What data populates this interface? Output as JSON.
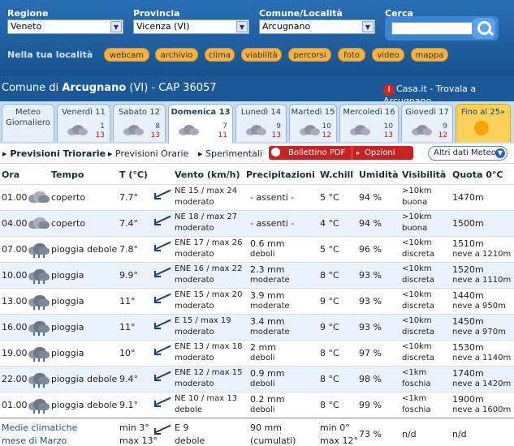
{
  "header": {
    "regione_label": "Regione",
    "regione_value": "Veneto",
    "provincia_label": "Provincia",
    "provincia_value": "Vicenza (VI)",
    "comune_label": "Comune/Località",
    "comune_value": "Arcugnano",
    "cerca_label": "Cerca",
    "cerca_value": "",
    "nella_label": "Nella tua località",
    "pills": [
      "webcam",
      "archivio",
      "clima",
      "viabilità",
      "percorsi",
      "foto",
      "video",
      "mappa"
    ]
  },
  "location_bar": {
    "prefix": "Comune di",
    "name": "Arcugnano",
    "suffix": "(VI) - CAP 36057",
    "casa_link": "Casa.it - Trovala a Arcugnano"
  },
  "day_tabs": [
    {
      "label": "Meteo Giornaliero",
      "lo": "",
      "hi": ""
    },
    {
      "label": "Venerdì 11",
      "lo": "1",
      "hi": "13"
    },
    {
      "label": "Sabato 12",
      "lo": "8",
      "hi": "13"
    },
    {
      "label": "Domenica 13",
      "lo": "7",
      "hi": "11"
    },
    {
      "label": "Lunedì 14",
      "lo": "9",
      "hi": "13"
    },
    {
      "label": "Martedì 15",
      "lo": "10",
      "hi": "12"
    },
    {
      "label": "Mercoledì 16",
      "lo": "10",
      "hi": "13"
    },
    {
      "label": "Giovedì 17",
      "lo": "9",
      "hi": "12"
    },
    {
      "label": "Fino al 25»",
      "lo": "",
      "hi": ""
    }
  ],
  "subnav": {
    "triorarie": "▸ Previsioni Triorarie",
    "orarie": "▸ Previsioni Orarie",
    "sperimentali": "▸ Sperimentali",
    "bollettino": "Bollettino PDF",
    "opzioni": "Opzioni",
    "altri": "Altri dati Meteo"
  },
  "table": {
    "headers": [
      "Ora",
      "Tempo",
      "T (°C)",
      "Vento (km/h)",
      "Precipitazioni",
      "W.chill",
      "Umidità",
      "Visibilità",
      "Quota 0°C"
    ],
    "rows": [
      {
        "ora": "01.00",
        "tempo": "coperto",
        "rain": false,
        "temp": "7.7°",
        "vento1": "NE 15 / max 24",
        "vento2": "moderato",
        "prec1": "- assenti -",
        "prec2": "",
        "wchill": "5 °C",
        "umid": "94 %",
        "vis1": ">10km",
        "vis2": "buona",
        "quota1": "1470m",
        "quota2": ""
      },
      {
        "ora": "04.00",
        "tempo": "coperto",
        "rain": false,
        "temp": "7.4°",
        "vento1": "NE 18 / max 27",
        "vento2": "moderato",
        "prec1": "- assenti -",
        "prec2": "",
        "wchill": "4 °C",
        "umid": "94 %",
        "vis1": ">10km",
        "vis2": "buona",
        "quota1": "1500m",
        "quota2": ""
      },
      {
        "ora": "07.00",
        "tempo": "pioggia debole",
        "rain": true,
        "temp": "7.8°",
        "vento1": "ENE 17 / max 26",
        "vento2": "moderato",
        "prec1": "0.6 mm",
        "prec2": "deboli",
        "wchill": "5 °C",
        "umid": "96 %",
        "vis1": "<10km",
        "vis2": "discreta",
        "quota1": "1510m",
        "quota2": "neve a 1210m"
      },
      {
        "ora": "10.00",
        "tempo": "pioggia",
        "rain": true,
        "temp": "9.9°",
        "vento1": "ENE 16 / max 22",
        "vento2": "moderato",
        "prec1": "2.3 mm",
        "prec2": "moderate",
        "wchill": "8 °C",
        "umid": "93 %",
        "vis1": "<10km",
        "vis2": "discreta",
        "quota1": "1520m",
        "quota2": "neve a 1110m"
      },
      {
        "ora": "13.00",
        "tempo": "pioggia",
        "rain": true,
        "temp": "11°",
        "vento1": "ENE 15 / max 20",
        "vento2": "moderato",
        "prec1": "3.9 mm",
        "prec2": "moderate",
        "wchill": "9 °C",
        "umid": "93 %",
        "vis1": "<10km",
        "vis2": "discreta",
        "quota1": "1440m",
        "quota2": "neve a 950m"
      },
      {
        "ora": "16.00",
        "tempo": "pioggia",
        "rain": true,
        "temp": "11°",
        "vento1": "E 15 / max 19",
        "vento2": "moderato",
        "prec1": "3.4 mm",
        "prec2": "moderate",
        "wchill": "9 °C",
        "umid": "93 %",
        "vis1": "<10km",
        "vis2": "discreta",
        "quota1": "1450m",
        "quota2": "neve a 970m"
      },
      {
        "ora": "19.00",
        "tempo": "pioggia",
        "rain": true,
        "temp": "10°",
        "vento1": "ENE 13 / max 18",
        "vento2": "moderato",
        "prec1": "2 mm",
        "prec2": "deboli",
        "wchill": "8 °C",
        "umid": "97 %",
        "vis1": "<10km",
        "vis2": "discreta",
        "quota1": "1530m",
        "quota2": "neve a 1140m"
      },
      {
        "ora": "22.00",
        "tempo": "pioggia debole",
        "rain": true,
        "temp": "9.4°",
        "vento1": "ENE 12 / max 15",
        "vento2": "moderato",
        "prec1": "0.9 mm",
        "prec2": "deboli",
        "wchill": "8 °C",
        "umid": "98 %",
        "vis1": "<1km",
        "vis2": "foschia",
        "quota1": "1740m",
        "quota2": "neve a 1420m"
      },
      {
        "ora": "01.00",
        "tempo": "pioggia debole",
        "rain": true,
        "temp": "9.1°",
        "vento1": "NE 10 / max 13",
        "vento2": "debole",
        "prec1": "0.2 mm",
        "prec2": "deboli",
        "wchill": "8 °C",
        "umid": "99 %",
        "vis1": "<1km",
        "vis2": "foschia",
        "quota1": "1900m",
        "quota2": "neve a 1600m"
      }
    ],
    "footer": {
      "label1": "Medie climatiche",
      "label2": "mese di Marzo",
      "tmin": "min 3°",
      "tmax": "max 13°",
      "vento1": "E 9",
      "vento2": "debole",
      "prec1": "90 mm",
      "prec2": "(cumulati)",
      "wmin": "min 0°",
      "wmax": "max 12°",
      "umid": "73 %",
      "vis": "n/d",
      "quota": "n/d"
    }
  }
}
